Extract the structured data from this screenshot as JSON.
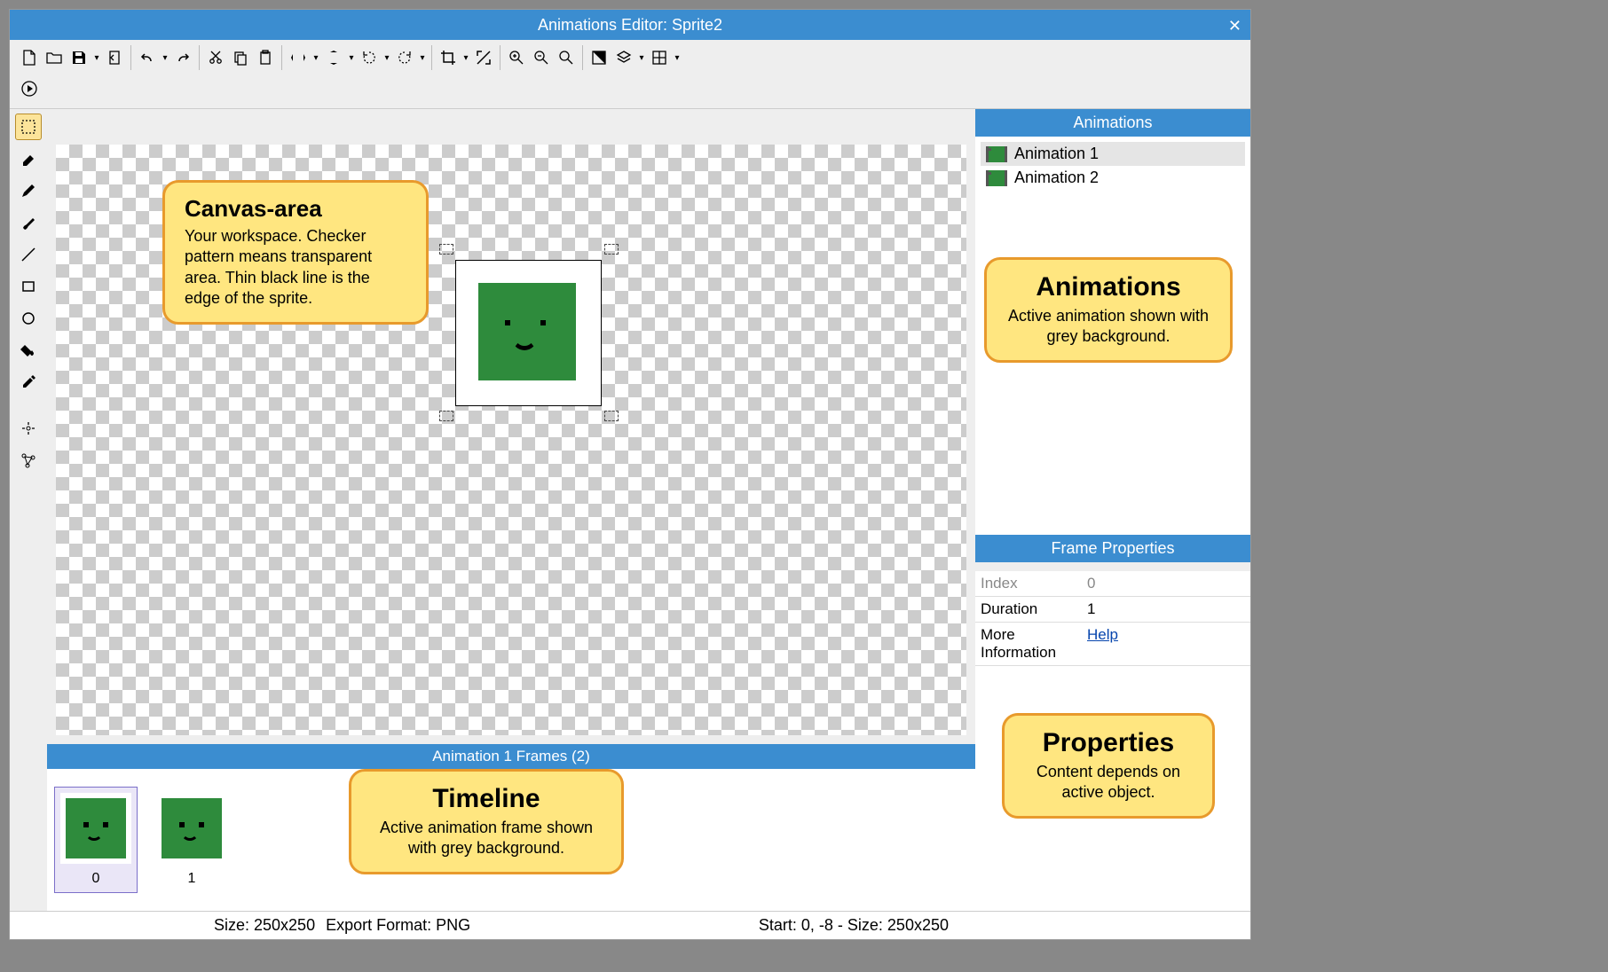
{
  "window": {
    "title": "Animations Editor: Sprite2"
  },
  "animations_panel": {
    "header": "Animations",
    "items": [
      {
        "name": "Animation 1",
        "active": true
      },
      {
        "name": "Animation 2",
        "active": false
      }
    ]
  },
  "frame_props": {
    "header": "Frame Properties",
    "index_label": "Index",
    "index_value": "0",
    "duration_label": "Duration",
    "duration_value": "1",
    "more_label": "More Information",
    "help_link": "Help"
  },
  "timeline": {
    "header": "Animation 1 Frames (2)",
    "frames": [
      {
        "label": "0",
        "active": true
      },
      {
        "label": "1",
        "active": false
      }
    ]
  },
  "statusbar": {
    "size": "Size: 250x250",
    "format": "Export Format: PNG",
    "start": "Start: 0, -8 - Size: 250x250"
  },
  "callouts": {
    "canvas_title": "Canvas-area",
    "canvas_text": "Your workspace. Checker pattern means transparent area. Thin black line is the edge of the sprite.",
    "animations_title": "Animations",
    "animations_text": "Active animation shown with grey background.",
    "timeline_title": "Timeline",
    "timeline_text": "Active animation frame shown with grey background.",
    "properties_title": "Properties",
    "properties_text": "Content depends on active object."
  }
}
